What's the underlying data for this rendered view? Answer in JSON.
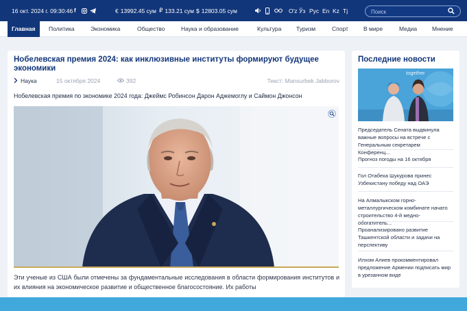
{
  "topbar": {
    "datetime": "16 окт. 2024 г. 09:30:46",
    "social_icons": [
      "facebook-icon",
      "instagram-icon",
      "telegram-icon"
    ],
    "currencies": [
      {
        "symbol": "€",
        "value": "13992.45 сум"
      },
      {
        "symbol": "₽",
        "value": "133.21 сум"
      },
      {
        "symbol": "$",
        "value": "12803.05 сум"
      }
    ],
    "tools": [
      "speaker-icon",
      "mobile-icon",
      "glasses-icon"
    ],
    "languages": [
      "O'z",
      "Ўз",
      "Рус",
      "En",
      "Kz",
      "Tj"
    ],
    "search_placeholder": "Поиск"
  },
  "nav": {
    "items": [
      "Главная",
      "Политика",
      "Экономика",
      "Общество",
      "Наука и образование",
      "Культура",
      "Туризм",
      "Спорт",
      "В мире",
      "Медиа",
      "Мнение"
    ],
    "active_index": 0
  },
  "article": {
    "title": "Нобелевская премия 2024: как инклюзивные институты формируют будущее экономики",
    "category": "Наука",
    "date": "15 октября 2024",
    "views": "392",
    "author": "Текст: Mansurbek Jabborov",
    "lead": "Нобелевская премия по экономике 2024 года: Джеймс Робинсон Дарон Аджемоглу и Саймон Джонсон",
    "body": "Эти ученые из США были отмечены за фундаментальные исследования в области формирования институтов и их влияния на экономическое развитие и общественное благосостояние. Их работы"
  },
  "sidebar": {
    "title": "Последние новости",
    "photo_caption_text": "together",
    "news": [
      "Председатель Сената выдвинула важные вопросы на встрече с Генеральным секретарем Конференц...",
      "Прогноз погоды на 16 октября",
      "Гол Отабека Шукурова принес Узбекистану победу над ОАЭ",
      "На Алмалыкском горно-металлургическом комбинате начато строительство 4-й медно-обогатитель...",
      "Проанализировано развитие Ташкентской области и задачи на перспективу",
      "Илхом Алиев прокомментировал предложение Армении подписать мир в урезанном виде"
    ]
  },
  "colors": {
    "brand": "#12367a",
    "accent_gold": "#c9a75a",
    "bottom_band": "#41a8dc"
  }
}
